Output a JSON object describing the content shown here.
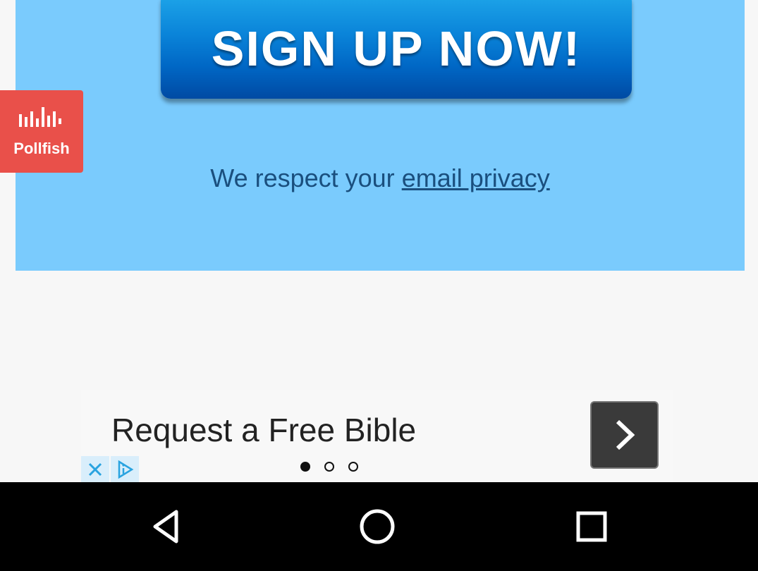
{
  "signup": {
    "button_label": "SIGN UP NOW!",
    "privacy_prefix": "We respect your ",
    "privacy_link": "email privacy"
  },
  "pollfish": {
    "label": "Pollfish",
    "icon": "pollfish-bars-icon"
  },
  "ad": {
    "text": "Request a Free Bible",
    "next_icon": "chevron-right-icon",
    "close_icon": "close-icon",
    "choices_icon": "ad-choices-icon",
    "dots": [
      "active",
      "inactive",
      "inactive"
    ]
  },
  "navbar": {
    "back_icon": "back-icon",
    "home_icon": "home-icon",
    "recents_icon": "recents-icon"
  },
  "colors": {
    "panel": "#7acbfd",
    "button": "#0a84d9",
    "pollfish": "#e9504a",
    "privacy_text": "#1a4f7e",
    "navbar": "#000000"
  }
}
